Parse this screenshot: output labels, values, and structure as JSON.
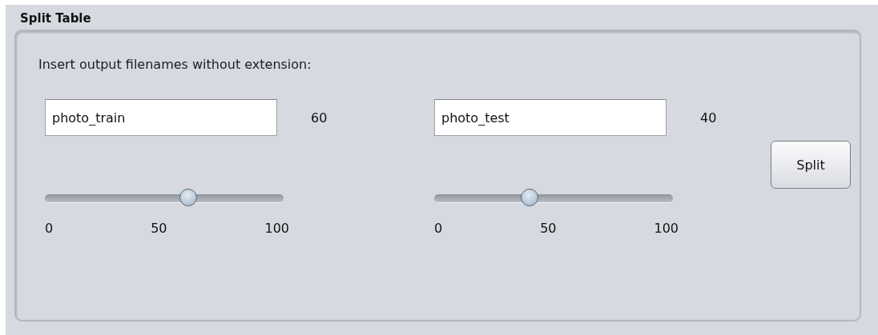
{
  "group": {
    "title": "Split Table"
  },
  "instruction": "Insert output filenames without extension:",
  "outputs": [
    {
      "filename": "photo_train",
      "percent": "60",
      "level": 0.6,
      "ticks": [
        "0",
        "50",
        "100"
      ]
    },
    {
      "filename": "photo_test",
      "percent": "40",
      "level": 0.4,
      "ticks": [
        "0",
        "50",
        "100"
      ]
    }
  ],
  "buttons": [
    "Split"
  ]
}
